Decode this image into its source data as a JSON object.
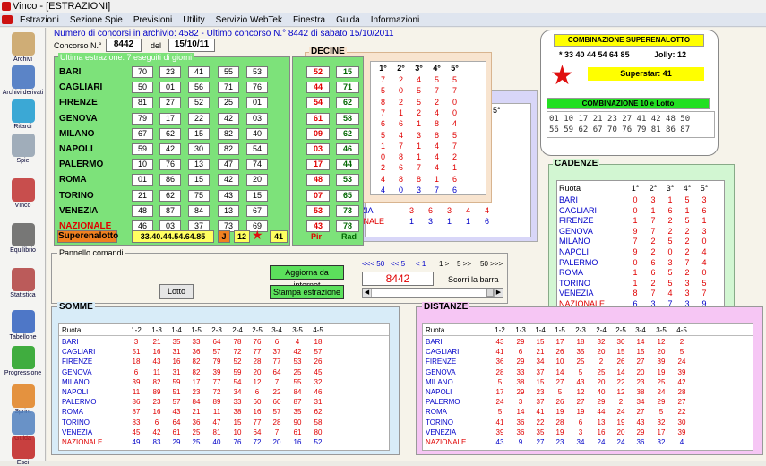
{
  "window": {
    "title": "Vinco - [ESTRAZIONI]"
  },
  "menu": [
    "Estrazioni",
    "Sezione Spie",
    "Previsioni",
    "Utility",
    "Servizio WebTek",
    "Finestra",
    "Guida",
    "Informazioni"
  ],
  "sidebar": [
    "Archivi",
    "Archivi derivati",
    "Ritardi",
    "Spie",
    "VInco",
    "Equilibrio",
    "Statistica",
    "Tabellone",
    "Progressione",
    "Sprint",
    "Guida",
    "Esci"
  ],
  "header": {
    "line": "Numero di concorsi in archivio: 4582  -  Ultimo concorso N.° 8442 di sabato 15/10/2011",
    "concorso_label": "Concorso N.°",
    "concorso_value": "8442",
    "del_label": "del",
    "date": "15/10/11"
  },
  "estrazioni": {
    "title": "Ultima estrazione: 7 eseguiti di giorni",
    "rows": [
      {
        "city": "BARI",
        "nums": [
          "70",
          "23",
          "41",
          "55",
          "53"
        ],
        "pir": "52",
        "rad": "15"
      },
      {
        "city": "CAGLIARI",
        "nums": [
          "50",
          "01",
          "56",
          "71",
          "76"
        ],
        "pir": "44",
        "rad": "71"
      },
      {
        "city": "FIRENZE",
        "nums": [
          "81",
          "27",
          "52",
          "25",
          "01"
        ],
        "pir": "54",
        "rad": "62"
      },
      {
        "city": "GENOVA",
        "nums": [
          "79",
          "17",
          "22",
          "42",
          "03"
        ],
        "pir": "61",
        "rad": "58"
      },
      {
        "city": "MILANO",
        "nums": [
          "67",
          "62",
          "15",
          "82",
          "40"
        ],
        "pir": "09",
        "rad": "62"
      },
      {
        "city": "NAPOLI",
        "nums": [
          "59",
          "42",
          "30",
          "82",
          "54"
        ],
        "pir": "03",
        "rad": "46"
      },
      {
        "city": "PALERMO",
        "nums": [
          "10",
          "76",
          "13",
          "47",
          "74"
        ],
        "pir": "17",
        "rad": "44"
      },
      {
        "city": "ROMA",
        "nums": [
          "01",
          "86",
          "15",
          "42",
          "20"
        ],
        "pir": "48",
        "rad": "53"
      },
      {
        "city": "TORINO",
        "nums": [
          "21",
          "62",
          "75",
          "43",
          "15"
        ],
        "pir": "07",
        "rad": "65"
      },
      {
        "city": "VENEZIA",
        "nums": [
          "48",
          "87",
          "84",
          "13",
          "67"
        ],
        "pir": "53",
        "rad": "73"
      },
      {
        "city": "NAZIONALE",
        "nums": [
          "46",
          "03",
          "37",
          "73",
          "69"
        ],
        "pir": "43",
        "rad": "78"
      }
    ],
    "superenalotto_label": "Superenalotto",
    "superenalotto_value": "33.40.44.54.64.85",
    "jolly_label": "J",
    "jolly_value": "12",
    "superstar_value": "41",
    "pir_label": "Pir",
    "rad_label": "Rad"
  },
  "decine": {
    "title": "DECINE",
    "headers": [
      "1°",
      "2°",
      "3°",
      "4°",
      "5°"
    ],
    "rows": [
      [
        "7",
        "2",
        "4",
        "5",
        "5"
      ],
      [
        "5",
        "0",
        "5",
        "7",
        "7"
      ],
      [
        "8",
        "2",
        "5",
        "2",
        "0"
      ],
      [
        "7",
        "1",
        "2",
        "4",
        "0"
      ],
      [
        "6",
        "6",
        "1",
        "8",
        "4"
      ],
      [
        "5",
        "4",
        "3",
        "8",
        "5"
      ],
      [
        "1",
        "7",
        "1",
        "4",
        "7"
      ],
      [
        "0",
        "8",
        "1",
        "4",
        "2"
      ],
      [
        "2",
        "6",
        "7",
        "4",
        "1"
      ],
      [
        "4",
        "8",
        "8",
        "1",
        "6"
      ],
      [
        "4",
        "0",
        "3",
        "7",
        "6"
      ]
    ]
  },
  "behind": {
    "header": "5°",
    "venezia_label": "VENEZIA",
    "venezia": [
      "3",
      "6",
      "3",
      "4",
      "4"
    ],
    "nazionale_label": "NAZIONALE",
    "nazionale": [
      "1",
      "3",
      "1",
      "1",
      "6"
    ]
  },
  "combo": {
    "title": "COMBINAZIONE SUPERENALOTTO",
    "numbers": "* 33 40 44 54 64 85",
    "jolly": "Jolly: 12",
    "superstar": "Superstar: 41",
    "title10": "COMBINAZIONE 10 e Lotto",
    "row1": "01 10 17 21 23 27 41 42 48 50",
    "row2": "56 59 62 67 70 76 79 81 86 87"
  },
  "cadenze": {
    "title": "CADENZE",
    "headers": [
      "Ruota",
      "1°",
      "2°",
      "3°",
      "4°",
      "5°"
    ],
    "rows": [
      {
        "city": "BARI",
        "v": [
          "0",
          "3",
          "1",
          "5",
          "3"
        ]
      },
      {
        "city": "CAGLIARI",
        "v": [
          "0",
          "1",
          "6",
          "1",
          "6"
        ]
      },
      {
        "city": "FIRENZE",
        "v": [
          "1",
          "7",
          "2",
          "5",
          "1"
        ]
      },
      {
        "city": "GENOVA",
        "v": [
          "9",
          "7",
          "2",
          "2",
          "3"
        ]
      },
      {
        "city": "MILANO",
        "v": [
          "7",
          "2",
          "5",
          "2",
          "0"
        ]
      },
      {
        "city": "NAPOLI",
        "v": [
          "9",
          "2",
          "0",
          "2",
          "4"
        ]
      },
      {
        "city": "PALERMO",
        "v": [
          "0",
          "6",
          "3",
          "7",
          "4"
        ]
      },
      {
        "city": "ROMA",
        "v": [
          "1",
          "6",
          "5",
          "2",
          "0"
        ]
      },
      {
        "city": "TORINO",
        "v": [
          "1",
          "2",
          "5",
          "3",
          "5"
        ]
      },
      {
        "city": "VENEZIA",
        "v": [
          "8",
          "7",
          "4",
          "3",
          "7"
        ]
      },
      {
        "city": "NAZIONALE",
        "v": [
          "6",
          "3",
          "7",
          "3",
          "9"
        ]
      }
    ]
  },
  "pannello": {
    "title": "Pannello comandi",
    "lotto": "Lotto",
    "aggiorna": "Aggiorna da internet",
    "stampa": "Stampa estrazione",
    "nav": [
      "<<< 50",
      "<< 5",
      "< 1",
      "1 >",
      "5 >>",
      "50 >>>"
    ],
    "concorso": "8442",
    "scorri": "Scorri la barra"
  },
  "somme": {
    "title": "SOMME",
    "headers": [
      "Ruota",
      "1-2",
      "1-3",
      "1-4",
      "1-5",
      "2-3",
      "2-4",
      "2-5",
      "3-4",
      "3-5",
      "4-5"
    ],
    "rows": [
      {
        "city": "BARI",
        "v": [
          "3",
          "21",
          "35",
          "33",
          "64",
          "78",
          "76",
          "6",
          "4",
          "18"
        ]
      },
      {
        "city": "CAGLIARI",
        "v": [
          "51",
          "16",
          "31",
          "36",
          "57",
          "72",
          "77",
          "37",
          "42",
          "57"
        ]
      },
      {
        "city": "FIRENZE",
        "v": [
          "18",
          "43",
          "16",
          "82",
          "79",
          "52",
          "28",
          "77",
          "53",
          "26"
        ]
      },
      {
        "city": "GENOVA",
        "v": [
          "6",
          "11",
          "31",
          "82",
          "39",
          "59",
          "20",
          "64",
          "25",
          "45"
        ]
      },
      {
        "city": "MILANO",
        "v": [
          "39",
          "82",
          "59",
          "17",
          "77",
          "54",
          "12",
          "7",
          "55",
          "32"
        ]
      },
      {
        "city": "NAPOLI",
        "v": [
          "11",
          "89",
          "51",
          "23",
          "72",
          "34",
          "6",
          "22",
          "84",
          "46"
        ]
      },
      {
        "city": "PALERMO",
        "v": [
          "86",
          "23",
          "57",
          "84",
          "89",
          "33",
          "60",
          "60",
          "87",
          "31"
        ]
      },
      {
        "city": "ROMA",
        "v": [
          "87",
          "16",
          "43",
          "21",
          "11",
          "38",
          "16",
          "57",
          "35",
          "62"
        ]
      },
      {
        "city": "TORINO",
        "v": [
          "83",
          "6",
          "64",
          "36",
          "47",
          "15",
          "77",
          "28",
          "90",
          "58"
        ]
      },
      {
        "city": "VENEZIA",
        "v": [
          "45",
          "42",
          "61",
          "25",
          "81",
          "10",
          "64",
          "7",
          "61",
          "80"
        ]
      },
      {
        "city": "NAZIONALE",
        "v": [
          "49",
          "83",
          "29",
          "25",
          "40",
          "76",
          "72",
          "20",
          "16",
          "52"
        ]
      }
    ]
  },
  "distanze": {
    "title": "DISTANZE",
    "headers": [
      "Ruota",
      "1-2",
      "1-3",
      "1-4",
      "1-5",
      "2-3",
      "2-4",
      "2-5",
      "3-4",
      "3-5",
      "4-5"
    ],
    "rows": [
      {
        "city": "BARI",
        "v": [
          "43",
          "29",
          "15",
          "17",
          "18",
          "32",
          "30",
          "14",
          "12",
          "2"
        ]
      },
      {
        "city": "CAGLIARI",
        "v": [
          "41",
          "6",
          "21",
          "26",
          "35",
          "20",
          "15",
          "15",
          "20",
          "5"
        ]
      },
      {
        "city": "FIRENZE",
        "v": [
          "36",
          "29",
          "34",
          "10",
          "25",
          "2",
          "26",
          "27",
          "39",
          "24"
        ]
      },
      {
        "city": "GENOVA",
        "v": [
          "28",
          "33",
          "37",
          "14",
          "5",
          "25",
          "14",
          "20",
          "19",
          "39"
        ]
      },
      {
        "city": "MILANO",
        "v": [
          "5",
          "38",
          "15",
          "27",
          "43",
          "20",
          "22",
          "23",
          "25",
          "42"
        ]
      },
      {
        "city": "NAPOLI",
        "v": [
          "17",
          "29",
          "23",
          "5",
          "12",
          "40",
          "12",
          "38",
          "24",
          "28"
        ]
      },
      {
        "city": "PALERMO",
        "v": [
          "24",
          "3",
          "37",
          "26",
          "27",
          "29",
          "2",
          "34",
          "29",
          "27"
        ]
      },
      {
        "city": "ROMA",
        "v": [
          "5",
          "14",
          "41",
          "19",
          "19",
          "44",
          "24",
          "27",
          "5",
          "22"
        ]
      },
      {
        "city": "TORINO",
        "v": [
          "41",
          "36",
          "22",
          "28",
          "6",
          "13",
          "19",
          "43",
          "32",
          "30"
        ]
      },
      {
        "city": "VENEZIA",
        "v": [
          "39",
          "36",
          "35",
          "19",
          "3",
          "16",
          "20",
          "29",
          "17",
          "39"
        ]
      },
      {
        "city": "NAZIONALE",
        "v": [
          "43",
          "9",
          "27",
          "23",
          "34",
          "24",
          "24",
          "36",
          "32",
          "4"
        ]
      }
    ]
  }
}
